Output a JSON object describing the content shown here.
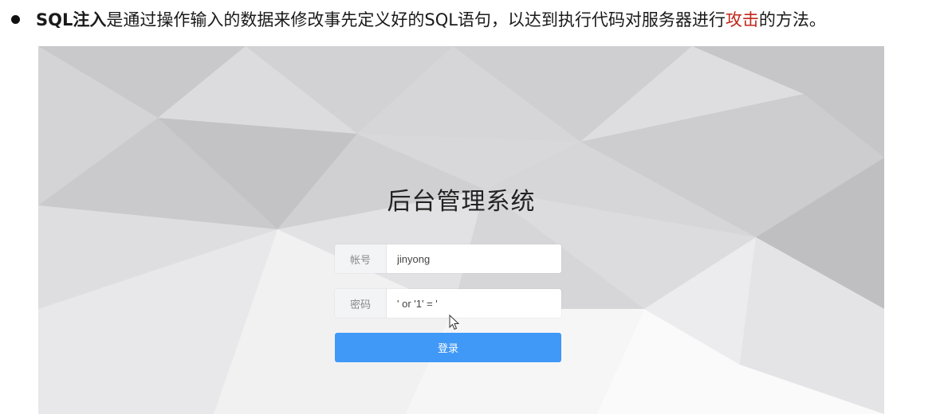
{
  "caption": {
    "bold_term": "SQL注入",
    "text_before_highlight": "是通过操作输入的数据来修改事先定义好的SQL语句，以达到执行代码对服务器进行",
    "highlight": "攻击",
    "text_after_highlight": "的方法。"
  },
  "login": {
    "title": "后台管理系统",
    "username_label": "帐号",
    "username_value": "jinyong",
    "password_label": "密码",
    "password_value": "' or '1' = '",
    "submit_label": "登录"
  },
  "colors": {
    "highlight": "#c0281c",
    "button": "#4098f7",
    "background": "#d9d9dc"
  }
}
